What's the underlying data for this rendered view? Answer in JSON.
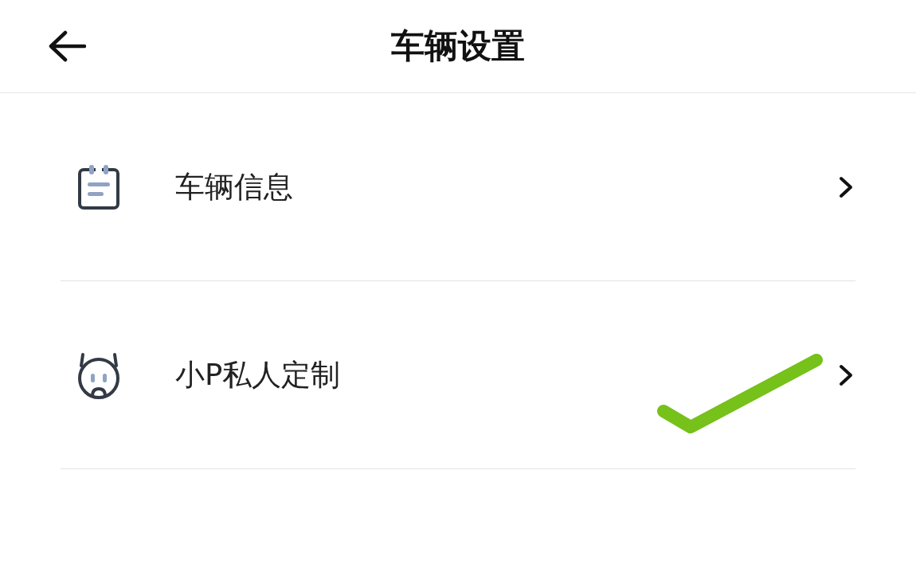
{
  "header": {
    "title": "车辆设置"
  },
  "items": [
    {
      "label": "车辆信息",
      "kind": "notepad",
      "annotated": false
    },
    {
      "label": "小P私人定制",
      "kind": "robot",
      "annotated": true
    }
  ]
}
